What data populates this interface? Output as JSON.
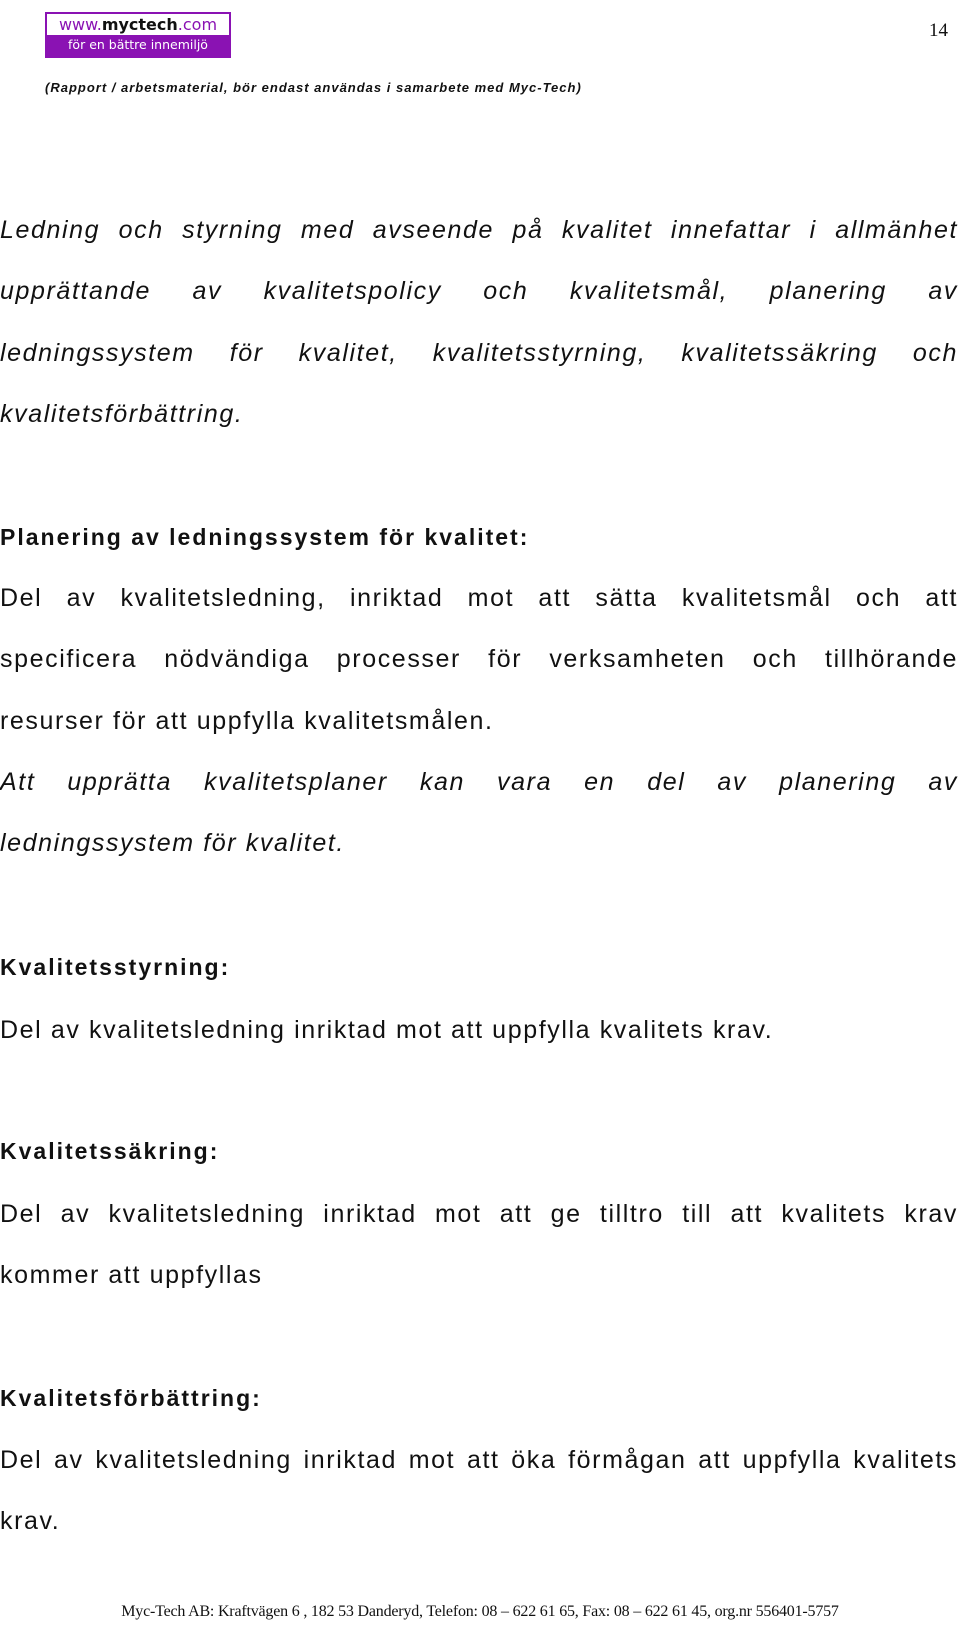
{
  "header": {
    "logo": {
      "prefix": "www.",
      "brand": "myctech",
      "suffix": ".com",
      "tagline": "för en bättre innemiljö",
      "color": "#8a12b3"
    },
    "page_number": "14",
    "notice": "(Rapport /  arbetsmaterial, bör endast användas i samarbete med Myc-Tech)"
  },
  "intro": {
    "lines": [
      "Ledning och styrning med avseende på kvalitet innefattar i allmänhet",
      "upprättande av kvalitetspolicy och kvalitetsmål, planering av",
      "ledningssystem för kvalitet, kvalitetsstyrning, kvalitetssäkring och",
      "kvalitetsförbättring."
    ]
  },
  "sections": [
    {
      "heading": "Planering av ledningssystem för kvalitet:",
      "body_lines": [
        "Del av kvalitetsledning, inriktad mot att sätta kvalitetsmål och att",
        "specificera nödvändiga processer för verksamheten och tillhörande",
        "resurser för att uppfylla kvalitetsmålen."
      ],
      "note_lines": [
        "Att upprätta kvalitetsplaner kan vara en del av planering av",
        "ledningssystem för kvalitet."
      ]
    },
    {
      "heading": "Kvalitetsstyrning:",
      "body_lines": [
        "Del av kvalitetsledning inriktad mot att uppfylla kvalitets krav."
      ]
    },
    {
      "heading": "Kvalitetssäkring:",
      "body_lines": [
        "Del av kvalitetsledning inriktad mot att ge tilltro till att kvalitets krav",
        "kommer att uppfyllas"
      ]
    },
    {
      "heading": "Kvalitetsförbättring:",
      "body_lines": [
        "Del av kvalitetsledning inriktad mot att öka förmågan att uppfylla kvalitets",
        "krav."
      ]
    }
  ],
  "footer": {
    "text": "Myc-Tech AB:  Kraftvägen 6 , 182 53  Danderyd,  Telefon:  08 – 622 61 65,  Fax: 08 – 622 61 45,  org.nr 556401-5757"
  }
}
